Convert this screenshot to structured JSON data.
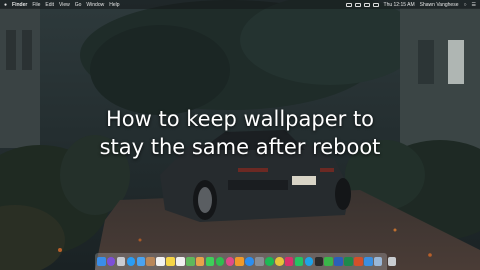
{
  "menubar": {
    "apple_icon": "apple-logo-icon",
    "items": [
      "Finder",
      "File",
      "Edit",
      "View",
      "Go",
      "Window",
      "Help"
    ],
    "time": "Thu 12:15 AM",
    "user": "Shawn Vanghese"
  },
  "overlay": {
    "line1": "How to keep wallpaper to",
    "line2": "stay the same after reboot"
  },
  "dock": {
    "apps": [
      {
        "name": "finder-icon",
        "color": "#3b8ee8"
      },
      {
        "name": "siri-icon",
        "color": "#7d4fd8"
      },
      {
        "name": "launchpad-icon",
        "color": "#c9ccd2"
      },
      {
        "name": "safari-icon",
        "color": "#2a9df4"
      },
      {
        "name": "mail-icon",
        "color": "#4aa3f0"
      },
      {
        "name": "contacts-icon",
        "color": "#b8875a"
      },
      {
        "name": "calendar-icon",
        "color": "#f2f2f2"
      },
      {
        "name": "notes-icon",
        "color": "#f5d547"
      },
      {
        "name": "reminders-icon",
        "color": "#f0f0f0"
      },
      {
        "name": "maps-icon",
        "color": "#5fb85c"
      },
      {
        "name": "photos-icon",
        "color": "#e8a24a"
      },
      {
        "name": "messages-icon",
        "color": "#3fcf5a"
      },
      {
        "name": "facetime-icon",
        "color": "#2fbf4f"
      },
      {
        "name": "itunes-icon",
        "color": "#e04a8a"
      },
      {
        "name": "ibooks-icon",
        "color": "#f09a2a"
      },
      {
        "name": "app-store-icon",
        "color": "#2b8ef0"
      },
      {
        "name": "system-preferences-icon",
        "color": "#8a8f96"
      },
      {
        "name": "spotify-icon",
        "color": "#1db954"
      },
      {
        "name": "chrome-icon",
        "color": "#e8c33a"
      },
      {
        "name": "slack-icon",
        "color": "#d9316c"
      },
      {
        "name": "whatsapp-icon",
        "color": "#25c462"
      },
      {
        "name": "skype-icon",
        "color": "#1fa3e8"
      },
      {
        "name": "terminal-icon",
        "color": "#2b2b2b"
      },
      {
        "name": "evernote-icon",
        "color": "#3bb54a"
      },
      {
        "name": "word-icon",
        "color": "#2b5fb8"
      },
      {
        "name": "excel-icon",
        "color": "#1e8a4a"
      },
      {
        "name": "powerpoint-icon",
        "color": "#d2502a"
      },
      {
        "name": "xcode-icon",
        "color": "#3a8fe0"
      },
      {
        "name": "preview-icon",
        "color": "#9ab7d6"
      }
    ],
    "trash": {
      "name": "trash-icon",
      "color": "#c8ccd0"
    }
  }
}
